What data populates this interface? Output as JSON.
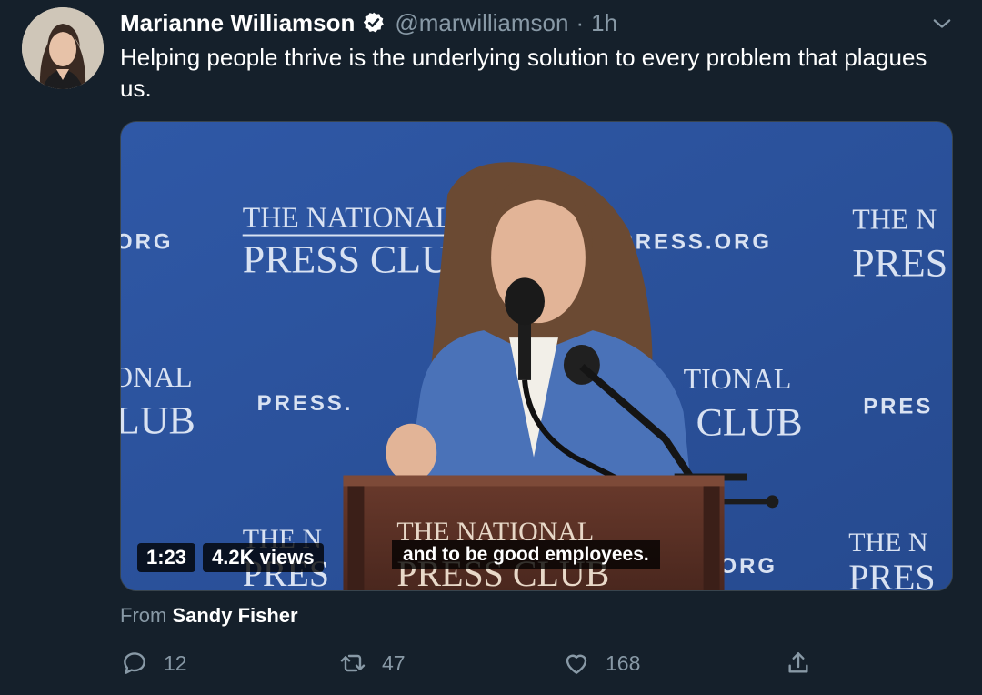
{
  "tweet": {
    "author": {
      "display_name": "Marianne Williamson",
      "handle": "@marwilliamson",
      "separator": "·",
      "time": "1h",
      "verified": true
    },
    "text": "Helping people thrive is the underlying solution to every problem that plagues us.",
    "media": {
      "type": "video",
      "duration": "1:23",
      "views": "4.2K views",
      "caption": "and to be good employees.",
      "backdrop_text": {
        "line1": "THE NATIONAL",
        "line2": "PRESS CLUB",
        "url_fragment": "PRESS.ORG",
        "tile1_line1": "ONAL",
        "tile1_line2": "LUB",
        "tile2_line1": "TIONAL",
        "tile2_line2": "CLUB",
        "tile3_line1": "THE N",
        "tile3_line2": "PRES",
        "url_left": "ORG",
        "url_mid": "PRESS.",
        "url_right": "PRES",
        "bottom_left_line1": "THE N",
        "bottom_left_line2": "PRES",
        "bottom_right_line1": "THE N",
        "bottom_right_line2": "PRES",
        "bottom_org": "ORG",
        "podium_line1": "THE NATIONAL",
        "podium_line2": "PRESS CLUB"
      }
    },
    "attribution": {
      "prefix": "From",
      "source": "Sandy Fisher"
    },
    "actions": {
      "replies": "12",
      "retweets": "47",
      "likes": "168"
    }
  },
  "colors": {
    "background": "#15202b",
    "secondary_text": "#8899a6",
    "verified_badge": "#ffffff",
    "backdrop_blue": "#2a4d95"
  },
  "icons": {
    "verified": "verified-badge-icon",
    "more": "chevron-down-icon",
    "reply": "reply-bubble-icon",
    "retweet": "retweet-icon",
    "like": "heart-icon",
    "share": "share-upload-icon"
  }
}
